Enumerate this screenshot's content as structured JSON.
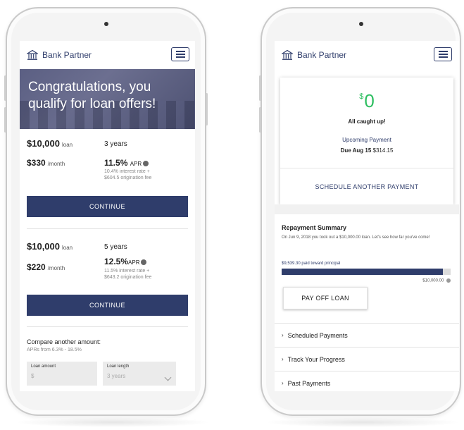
{
  "brand": {
    "name": "Bank Partner"
  },
  "left": {
    "hero_title": "Congratulations, you qualify for loan offers!",
    "offers": [
      {
        "amount": "$10,000",
        "amount_unit": "loan",
        "term": "3 years",
        "monthly": "$330",
        "monthly_unit": "/month",
        "apr": "11.5%",
        "apr_label": "APR",
        "fine_line1": "10.4% interest rate +",
        "fine_line2": "$604.5 origination fee",
        "cta": "CONTINUE"
      },
      {
        "amount": "$10,000",
        "amount_unit": "loan",
        "term": "5 years",
        "monthly": "$220",
        "monthly_unit": "/month",
        "apr": "12.5%",
        "apr_label": "APR",
        "fine_line1": "11.5% interest rate +",
        "fine_line2": "$643.2 origination fee",
        "cta": "CONTINUE"
      }
    ],
    "compare": {
      "title": "Compare another amount:",
      "subtitle": "APRs from 6.3% - 18.5%",
      "loan_amount_label": "Loan amount",
      "loan_amount_value": "$",
      "loan_length_label": "Loan length",
      "loan_length_value": "3 years"
    }
  },
  "right": {
    "balance_symbol": "$",
    "balance": "0",
    "status": "All caught up!",
    "upcoming_label": "Upcoming Payment",
    "due_label": "Due Aug 15",
    "due_amount": "$314.15",
    "schedule_link": "SCHEDULE ANOTHER PAYMENT",
    "summary_title": "Repayment Summary",
    "summary_text": "On Jun 9, 2018 you took out a $10,000.00 loan. Let's see how far you've come!",
    "paid_label": "$9,539.30 paid toward principal",
    "total_label": "$10,000.00",
    "progress_fraction": 0.954,
    "payoff_button": "PAY OFF LOAN",
    "accordion": [
      "Scheduled Payments",
      "Track Your Progress",
      "Past Payments"
    ]
  },
  "colors": {
    "primary": "#2f3d6b",
    "success": "#2dbe60",
    "hero": "#5b5f83"
  }
}
